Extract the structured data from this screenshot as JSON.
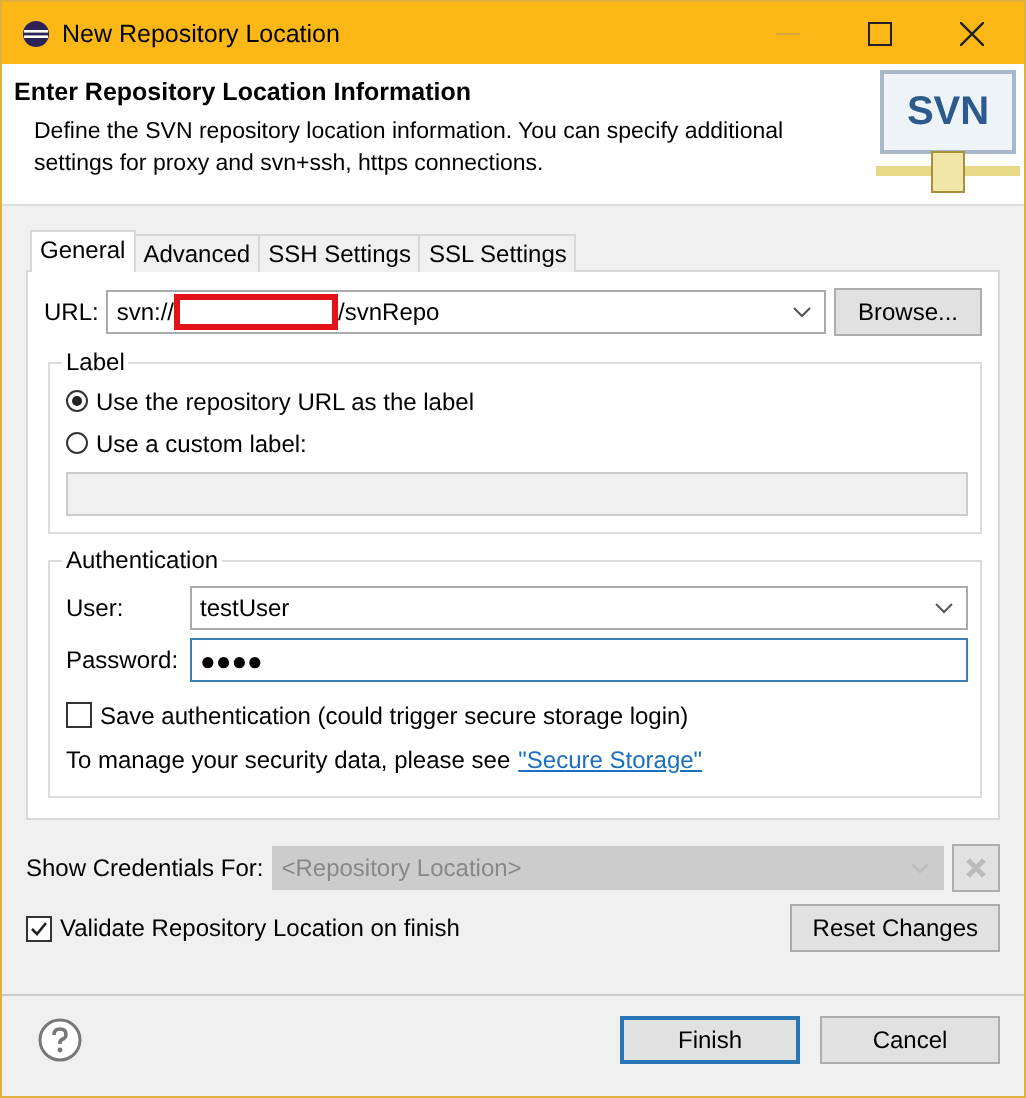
{
  "window": {
    "title": "New Repository Location"
  },
  "header": {
    "title": "Enter Repository Location Information",
    "description": "Define the SVN repository location information. You can specify additional settings for proxy and svn+ssh, https connections.",
    "logo_text": "SVN"
  },
  "tabs": [
    {
      "label": "General",
      "selected": true
    },
    {
      "label": "Advanced",
      "selected": false
    },
    {
      "label": "SSH Settings",
      "selected": false
    },
    {
      "label": "SSL Settings",
      "selected": false
    }
  ],
  "url": {
    "label": "URL:",
    "prefix": "svn://",
    "redacted": true,
    "suffix": "/svnRepo",
    "browse_button": "Browse..."
  },
  "label_group": {
    "title": "Label",
    "options": [
      {
        "label": "Use the repository URL as the label",
        "selected": true
      },
      {
        "label": "Use a custom label:",
        "selected": false
      }
    ],
    "custom_label_disabled": true
  },
  "authentication": {
    "title": "Authentication",
    "user_label": "User:",
    "user": "testUser",
    "password_label": "Password:",
    "password": "●●●●",
    "password_focused": true,
    "save": {
      "label": "Save authentication (could trigger secure storage login)",
      "checked": false
    },
    "note": "To manage your security data, please see",
    "link": "\"Secure Storage\""
  },
  "credentials": {
    "label": "Show Credentials For:",
    "value": "<Repository Location>",
    "disabled": true
  },
  "validate": {
    "label": "Validate Repository Location on finish",
    "checked": true
  },
  "reset_button": "Reset Changes",
  "buttons": [
    {
      "label": "Finish",
      "default": true
    },
    {
      "label": "Cancel",
      "default": false
    }
  ]
}
